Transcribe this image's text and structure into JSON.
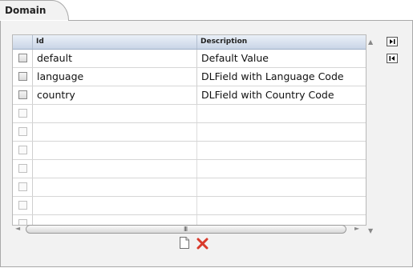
{
  "panel": {
    "title": "Domain"
  },
  "grid": {
    "columns": {
      "id": "Id",
      "description": "Description"
    },
    "rows": [
      {
        "id": "default",
        "description": "Default Value"
      },
      {
        "id": "language",
        "description": "DLField with Language Code"
      },
      {
        "id": "country",
        "description": "DLField with Country Code"
      }
    ],
    "empty_row_count": 7
  },
  "scroll": {
    "grip": "III"
  },
  "icons": {
    "move_last": "move-last-icon",
    "move_first": "move-first-icon",
    "new": "new-document-icon",
    "delete": "delete-icon"
  },
  "colors": {
    "header_top": "#eaf0f8",
    "header_bottom": "#c9d5e6",
    "delete": "#d93a2b"
  }
}
